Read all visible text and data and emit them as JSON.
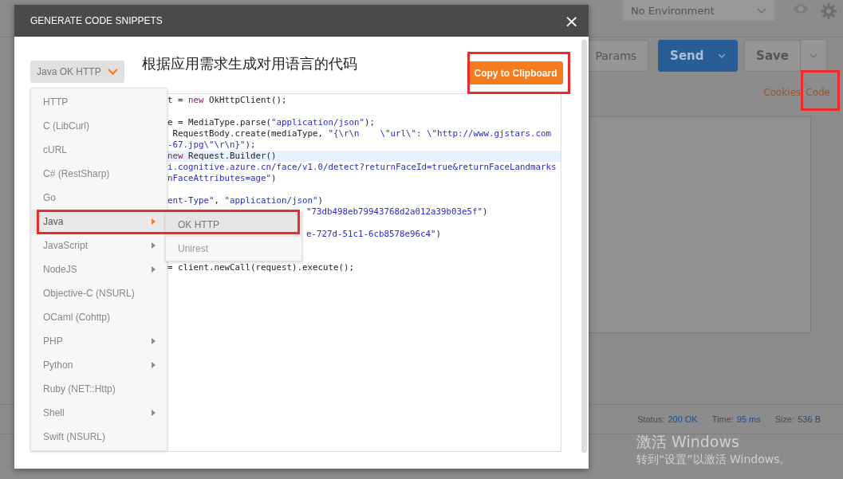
{
  "background": {
    "environment": "No Environment",
    "buttons": [
      {
        "label": "Params",
        "kind": "plain"
      },
      {
        "label": "Send",
        "kind": "primary"
      },
      {
        "label": "Save",
        "kind": "plain"
      }
    ],
    "links": [
      "Cookies",
      "Code"
    ],
    "status": [
      {
        "label": "Status:",
        "value": "200 OK"
      },
      {
        "label": "Time:",
        "value": "95 ms"
      },
      {
        "label": "Size:",
        "value": "536 B"
      }
    ]
  },
  "dialog": {
    "title": "GENERATE CODE SNIPPETS",
    "close": "×",
    "language_select": "Java OK HTTP",
    "heading": "根据应用需求生成对用语言的代码",
    "copy_button": "Copy to Clipboard",
    "code_lines": [
      {
        "highlighted": false,
        "parts": [
          {
            "kind": "plain",
            "text": "t = "
          },
          {
            "kind": "keyword",
            "text": "new"
          },
          {
            "kind": "plain",
            "text": " OkHttpClient();"
          }
        ]
      },
      {
        "highlighted": false
      },
      {
        "highlighted": false,
        "parts": [
          {
            "kind": "plain",
            "text": "e = MediaType.parse("
          },
          {
            "kind": "string",
            "text": "\"application/json\""
          },
          {
            "kind": "plain",
            "text": ");"
          }
        ]
      },
      {
        "highlighted": false,
        "parts": [
          {
            "kind": "plain",
            "text": " RequestBody.create(mediaType, "
          },
          {
            "kind": "string",
            "text": "\"{\\r\\n    \\\"url\\\": \\\"http://www.gjstars.com"
          }
        ]
      },
      {
        "highlighted": false,
        "parts": [
          {
            "kind": "string",
            "text": "-67.jpg\\\"\\r\\n}\""
          },
          {
            "kind": "plain",
            "text": ");"
          }
        ]
      },
      {
        "highlighted": true,
        "parts": [
          {
            "kind": "keyword",
            "text": "new"
          },
          {
            "kind": "plain",
            "text": " Request.Builder()"
          }
        ]
      },
      {
        "highlighted": false,
        "parts": [
          {
            "kind": "string",
            "text": "i.cognitive.azure.cn/face/v1.0/detect?returnFaceId=true&returnFaceLandmarks"
          }
        ]
      },
      {
        "highlighted": false,
        "parts": [
          {
            "kind": "string",
            "text": "nFaceAttributes=age\""
          },
          {
            "kind": "plain",
            "text": ")"
          }
        ]
      },
      {
        "highlighted": false
      },
      {
        "highlighted": false,
        "parts": [
          {
            "kind": "string",
            "text": "ent-Type\""
          },
          {
            "kind": "plain",
            "text": ", "
          },
          {
            "kind": "string",
            "text": "\"application/json\""
          },
          {
            "kind": "plain",
            "text": ")"
          }
        ]
      },
      {
        "highlighted": false,
        "kind": "partial",
        "parts": [
          {
            "kind": "string",
            "text": "\"73db498eb79943768d2a012a39b03e5f\""
          },
          {
            "kind": "plain",
            "text": ")"
          }
        ]
      },
      {
        "highlighted": false
      },
      {
        "highlighted": false,
        "kind": "partial",
        "parts": [
          {
            "kind": "string",
            "text": "e-727d-51c1-6cb8578e96c4\""
          },
          {
            "kind": "plain",
            "text": ")"
          }
        ]
      },
      {
        "highlighted": false
      },
      {
        "highlighted": false
      },
      {
        "highlighted": false,
        "parts": [
          {
            "kind": "plain",
            "text": "= client.newCall(request).execute();"
          }
        ]
      }
    ],
    "languages": [
      {
        "label": "HTTP",
        "submenu": false,
        "selected": false
      },
      {
        "label": "C (LibCurl)",
        "submenu": false,
        "selected": false
      },
      {
        "label": "cURL",
        "submenu": false,
        "selected": false
      },
      {
        "label": "C# (RestSharp)",
        "submenu": false,
        "selected": false
      },
      {
        "label": "Go",
        "submenu": false,
        "selected": false
      },
      {
        "label": "Java",
        "submenu": true,
        "selected": true
      },
      {
        "label": "JavaScript",
        "submenu": true,
        "selected": false
      },
      {
        "label": "NodeJS",
        "submenu": true,
        "selected": false
      },
      {
        "label": "Objective-C (NSURL)",
        "submenu": false,
        "selected": false
      },
      {
        "label": "OCaml (Cohttp)",
        "submenu": false,
        "selected": false
      },
      {
        "label": "PHP",
        "submenu": true,
        "selected": false
      },
      {
        "label": "Python",
        "submenu": true,
        "selected": false
      },
      {
        "label": "Ruby (NET::Http)",
        "submenu": false,
        "selected": false
      },
      {
        "label": "Shell",
        "submenu": true,
        "selected": false
      },
      {
        "label": "Swift (NSURL)",
        "submenu": false,
        "selected": false
      }
    ],
    "variants": [
      {
        "label": "OK HTTP",
        "selected": true
      },
      {
        "label": "Unirest",
        "selected": false
      }
    ]
  },
  "os_watermark": {
    "title": "激活 Windows",
    "subtitle": "转到“设置”以激活 Windows。"
  }
}
